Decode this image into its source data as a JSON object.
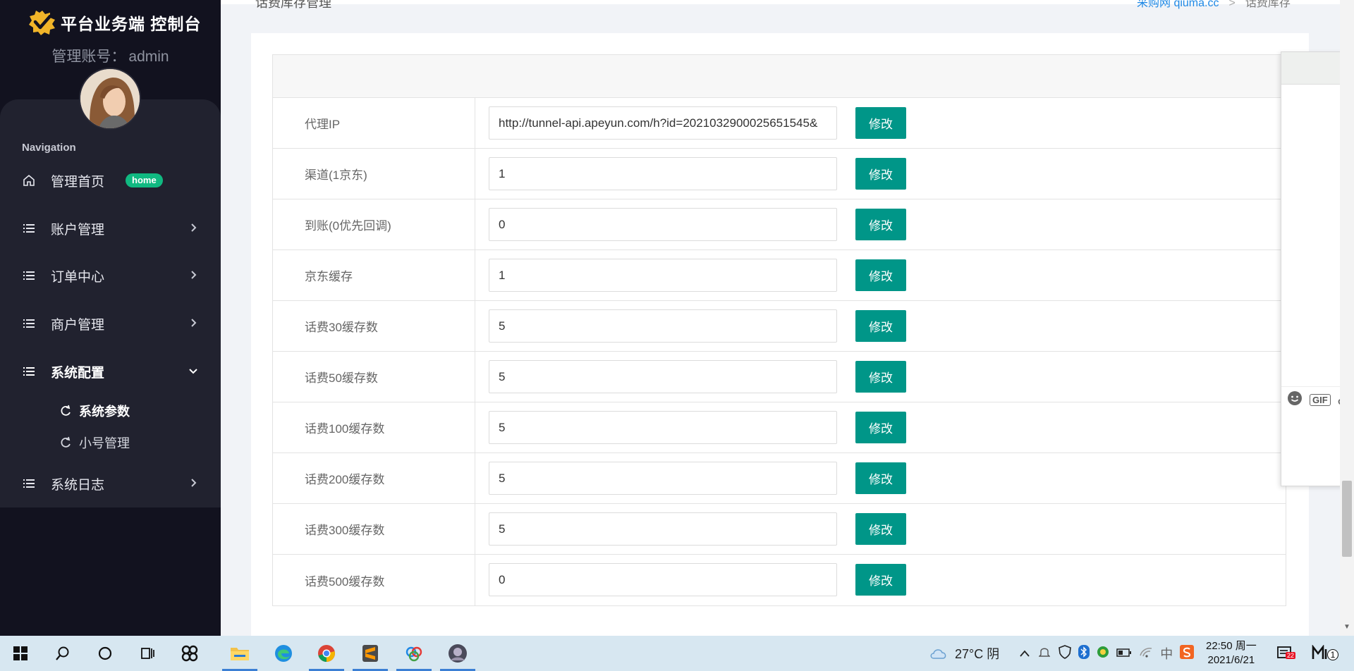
{
  "brand": {
    "title": "平台业务端 控制台"
  },
  "account": {
    "label": "管理账号：",
    "name": "admin"
  },
  "nav": {
    "heading": "Navigation",
    "items": [
      {
        "label": "管理首页",
        "badge": "home",
        "icon": "home-icon"
      },
      {
        "label": "账户管理",
        "icon": "list-icon"
      },
      {
        "label": "订单中心",
        "icon": "list-icon"
      },
      {
        "label": "商户管理",
        "icon": "list-icon"
      },
      {
        "label": "系统配置",
        "icon": "list-icon",
        "expanded": true
      },
      {
        "label": "系统日志",
        "icon": "list-icon"
      }
    ],
    "sub_items": [
      {
        "label": "系统参数",
        "active": true
      },
      {
        "label": "小号管理"
      }
    ]
  },
  "breadcrumb": {
    "left_title": "话费库存管理",
    "home_link": "采购网 qiuma.cc",
    "current": "话费库存"
  },
  "settings": {
    "button_label": "修改",
    "rows": [
      {
        "label": "代理IP",
        "value": "http://tunnel-api.apeyun.com/h?id=2021032900025651545&"
      },
      {
        "label": "渠道(1京东)",
        "value": "1"
      },
      {
        "label": "到账(0优先回调)",
        "value": "0"
      },
      {
        "label": "京东缓存",
        "value": "1"
      },
      {
        "label": "话费30缓存数",
        "value": "5"
      },
      {
        "label": "话费50缓存数",
        "value": "5"
      },
      {
        "label": "话费100缓存数",
        "value": "5"
      },
      {
        "label": "话费200缓存数",
        "value": "5"
      },
      {
        "label": "话费300缓存数",
        "value": "5"
      },
      {
        "label": "话费500缓存数",
        "value": "0"
      }
    ]
  },
  "widget": {
    "gif_label": "GIF"
  },
  "taskbar": {
    "weather": "27°C 阴",
    "ime": "中",
    "time": "22:50 周一",
    "date": "2021/6/21",
    "notifications": "22",
    "mail_count": "1"
  },
  "colors": {
    "sidebar_bg": "#12121f",
    "sidebar_panel": "#21222f",
    "button_teal": "#009688",
    "badge_green": "#10b981",
    "link_blue": "#1e88e5",
    "taskbar_bg": "#d7e7f1"
  }
}
